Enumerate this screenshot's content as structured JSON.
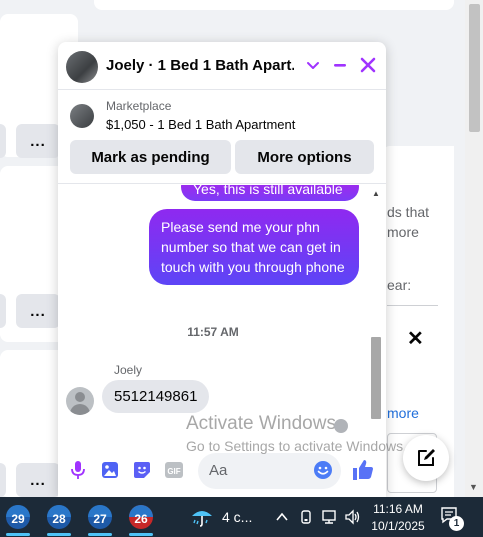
{
  "chat": {
    "title": "Joely · 1 Bed 1 Bath Apart...",
    "marketplace": {
      "label": "Marketplace",
      "description": "$1,050 - 1 Bed 1 Bath Apartment",
      "mark_pending_label": "Mark as pending",
      "more_options_label": "More options"
    },
    "messages": {
      "outgoing_1": "Yes, this is still available",
      "outgoing_2": "Please send me your phn number so that we can get in touch with you through phone",
      "timestamp": "11:57 AM",
      "incoming_sender": "Joely",
      "incoming_1": "5512149861"
    },
    "composer": {
      "placeholder": "Aa"
    },
    "accent_color": "#a033ff"
  },
  "background": {
    "more_button": "...",
    "partial_text_1": "ds that",
    "partial_text_2": "more",
    "partial_text_3": "ear:",
    "partial_link": "more",
    "close_glyph": "✕"
  },
  "watermark": {
    "line1": "Activate Windows",
    "line2": "Go to Settings to activate Windows."
  },
  "taskbar": {
    "apps": [
      "29",
      "28",
      "27",
      "26"
    ],
    "weather": "4 c...",
    "time": "11:16 AM",
    "date": "10/1/2025",
    "notification_count": "1"
  }
}
